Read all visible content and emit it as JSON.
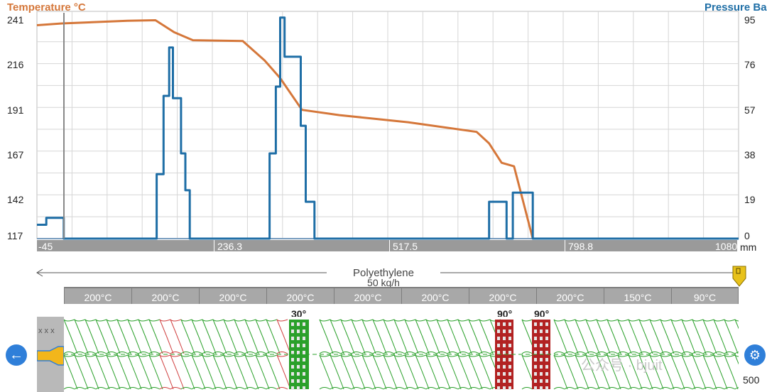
{
  "chart_data": {
    "type": "line",
    "title": "",
    "left_axis_label": "Temperature °C",
    "right_axis_label": "Pressure Ba",
    "left_ticks": [
      241,
      216,
      191,
      167,
      142,
      117
    ],
    "right_ticks": [
      95,
      76,
      57,
      38,
      19,
      0
    ],
    "x_ticks": [
      "-45",
      "236.3",
      "517.5",
      "798.8",
      "1080"
    ],
    "x_unit": "mm",
    "xlim": [
      -45,
      1080
    ],
    "temp_ylim": [
      117,
      241
    ],
    "pressure_ylim": [
      0,
      95
    ],
    "grid": true,
    "series": [
      {
        "axis": "left",
        "color": "#d5773a",
        "points": [
          [
            -45,
            238
          ],
          [
            -5,
            239
          ],
          [
            100,
            240.5
          ],
          [
            145,
            240.8
          ],
          [
            175,
            234
          ],
          [
            205,
            229.5
          ],
          [
            285,
            229
          ],
          [
            320,
            218
          ],
          [
            345,
            208
          ],
          [
            380,
            190
          ],
          [
            440,
            187
          ],
          [
            550,
            183
          ],
          [
            660,
            177.5
          ],
          [
            680,
            171
          ],
          [
            700,
            160
          ],
          [
            720,
            158
          ],
          [
            750,
            117
          ]
        ]
      },
      {
        "axis": "right",
        "color": "#1e6ea6",
        "points": [
          [
            -45,
            6
          ],
          [
            -30,
            6
          ],
          [
            -30,
            9
          ],
          [
            -2,
            9
          ],
          [
            -2,
            0
          ],
          [
            147,
            0
          ],
          [
            147,
            28
          ],
          [
            158,
            28
          ],
          [
            158,
            62
          ],
          [
            167,
            62
          ],
          [
            167,
            83
          ],
          [
            173,
            83
          ],
          [
            173,
            61
          ],
          [
            186,
            61
          ],
          [
            186,
            37
          ],
          [
            193,
            37
          ],
          [
            193,
            21
          ],
          [
            200,
            21
          ],
          [
            200,
            0
          ],
          [
            328,
            0
          ],
          [
            328,
            37
          ],
          [
            338,
            37
          ],
          [
            338,
            66
          ],
          [
            345,
            66
          ],
          [
            345,
            96
          ],
          [
            352,
            96
          ],
          [
            352,
            79
          ],
          [
            378,
            79
          ],
          [
            378,
            49
          ],
          [
            386,
            49
          ],
          [
            386,
            16
          ],
          [
            400,
            16
          ],
          [
            400,
            0
          ],
          [
            680,
            0
          ],
          [
            680,
            16
          ],
          [
            708,
            16
          ],
          [
            708,
            0
          ],
          [
            718,
            0
          ],
          [
            718,
            20
          ],
          [
            750,
            20
          ],
          [
            750,
            0
          ],
          [
            1080,
            0
          ]
        ]
      }
    ]
  },
  "process": {
    "material": "Polyethylene",
    "rate": "50 kg/h",
    "zones": [
      "200°C",
      "200°C",
      "200°C",
      "200°C",
      "200°C",
      "200°C",
      "200°C",
      "200°C",
      "150°C",
      "90°C"
    ]
  },
  "screw": {
    "angles": [
      "30°",
      "90°",
      "90°"
    ],
    "speed": "500",
    "feed_labels": "x x x",
    "colors": {
      "normal": "#2aa02a",
      "reverse": "#d04040",
      "neutral": "#2aa02a",
      "kneading_green": "#2aa02a",
      "kneading_red": "#b22222"
    }
  },
  "controls": {
    "back_icon": "arrow-left-icon",
    "settings_icon": "gear-icon"
  },
  "watermark": "公众号 · bjuit"
}
